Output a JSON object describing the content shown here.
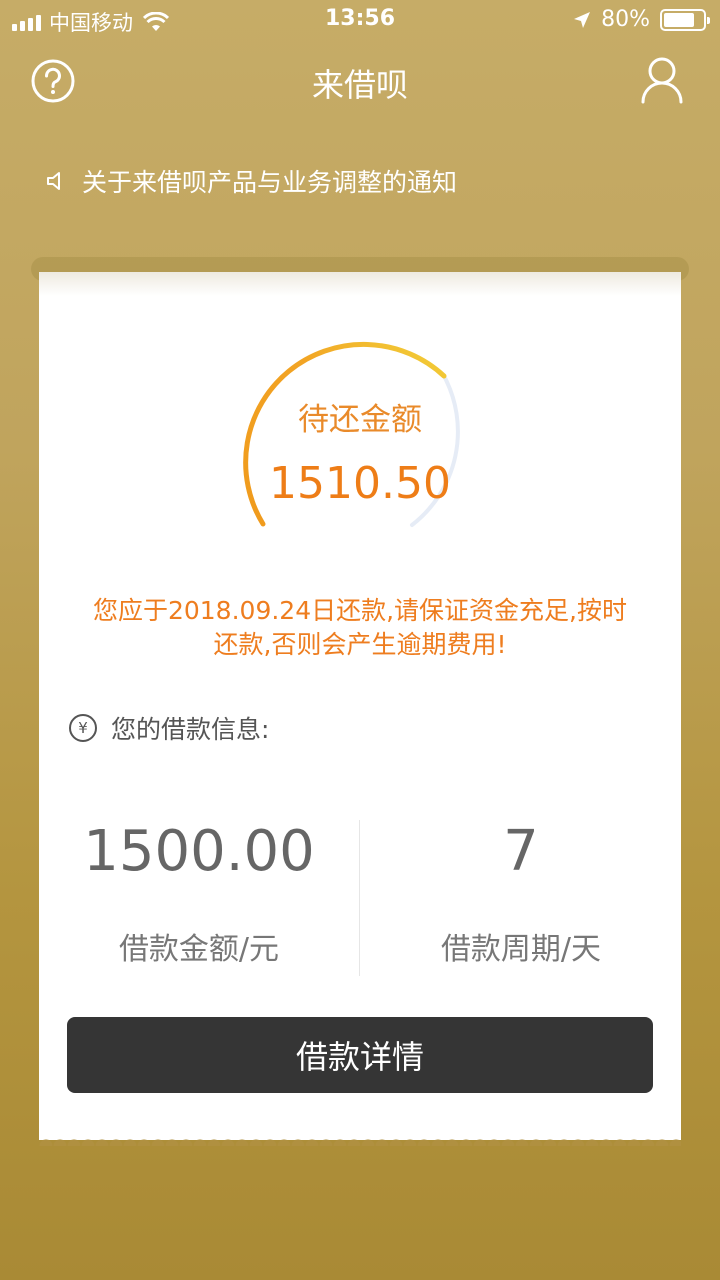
{
  "status_bar": {
    "carrier": "中国移动",
    "time": "13:56",
    "battery_text": "80%",
    "battery_level": 0.8
  },
  "nav": {
    "title": "来借呗",
    "help_icon": "question-circle-icon",
    "user_icon": "user-icon"
  },
  "notice": {
    "icon": "speaker-icon",
    "text": "关于来借呗产品与业务调整的通知"
  },
  "summary": {
    "label": "待还金额",
    "amount": "1510.50",
    "colors": {
      "accent": "#ee7d17",
      "arc_start": "#f0a020",
      "arc_end": "#f2d13a",
      "arc_track": "#e6ecf6"
    }
  },
  "warning": {
    "line1": "您应于2018.09.24日还款,请保证资金充足,按时",
    "line2": "还款,否则会产生逾期费用!"
  },
  "loan_info": {
    "title": "您的借款信息:",
    "icon": "yen-icon",
    "amount_value": "1500.00",
    "amount_label": "借款金额/元",
    "period_value": "7",
    "period_label": "借款周期/天"
  },
  "actions": {
    "detail_button": "借款详情"
  }
}
